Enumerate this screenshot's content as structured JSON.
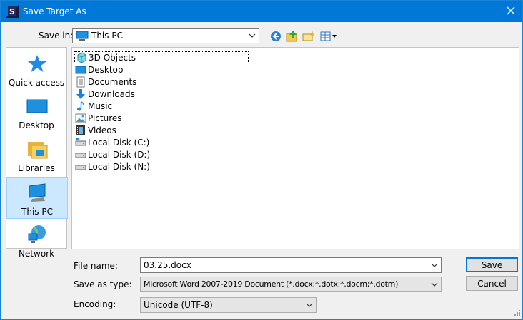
{
  "window": {
    "title": "Save Target As"
  },
  "save_in": {
    "label": "Save in:",
    "value": "This PC"
  },
  "toolbar": [
    "back-icon",
    "up-folder-icon",
    "new-folder-icon",
    "view-menu-icon"
  ],
  "places": [
    {
      "label": "Quick access",
      "icon": "star-icon"
    },
    {
      "label": "Desktop",
      "icon": "desktop-icon"
    },
    {
      "label": "Libraries",
      "icon": "libraries-icon"
    },
    {
      "label": "This PC",
      "icon": "this-pc-icon",
      "selected": true
    },
    {
      "label": "Network",
      "icon": "network-icon"
    }
  ],
  "files": [
    {
      "name": "3D Objects",
      "icon": "3d-objects-icon"
    },
    {
      "name": "Desktop",
      "icon": "desktop-folder-icon"
    },
    {
      "name": "Documents",
      "icon": "documents-icon"
    },
    {
      "name": "Downloads",
      "icon": "downloads-icon"
    },
    {
      "name": "Music",
      "icon": "music-icon"
    },
    {
      "name": "Pictures",
      "icon": "pictures-icon"
    },
    {
      "name": "Videos",
      "icon": "videos-icon"
    },
    {
      "name": "Local Disk (C:)",
      "icon": "drive-icon"
    },
    {
      "name": "Local Disk (D:)",
      "icon": "drive-icon"
    },
    {
      "name": "Local Disk (N:)",
      "icon": "drive-icon"
    }
  ],
  "filename": {
    "label": "File name:",
    "value": "03.25.docx"
  },
  "save_type": {
    "label": "Save as type:",
    "value": "Microsoft Word 2007-2019 Document (*.docx;*.dotx;*.docm;*.dotm)"
  },
  "encoding": {
    "label": "Encoding:",
    "value": "Unicode (UTF-8)"
  },
  "buttons": {
    "save": "Save",
    "cancel": "Cancel"
  }
}
